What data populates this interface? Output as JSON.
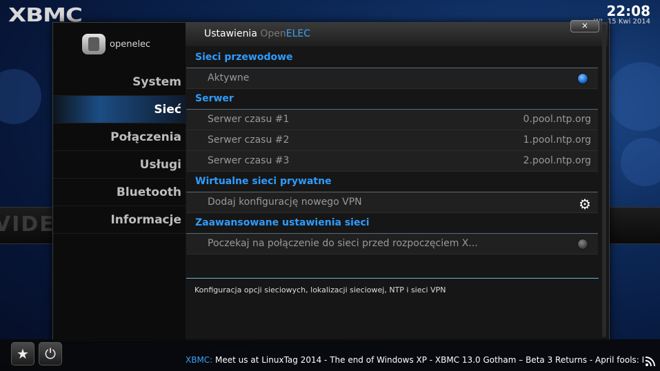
{
  "app": {
    "logo": "XBMC"
  },
  "status": {
    "time": "22:08",
    "date": "Wt, 15 Kwi 2014"
  },
  "background": {
    "band_text": "VIDEO"
  },
  "dialog": {
    "brand": "openelec",
    "title_prefix": "Ustawienia ",
    "title_open": "Open",
    "title_elec": "ELEC",
    "close_label": "×"
  },
  "sidebar": {
    "items": [
      {
        "label": "System",
        "active": false
      },
      {
        "label": "Sieć",
        "active": true
      },
      {
        "label": "Połączenia",
        "active": false
      },
      {
        "label": "Usługi",
        "active": false
      },
      {
        "label": "Bluetooth",
        "active": false
      },
      {
        "label": "Informacje",
        "active": false
      }
    ]
  },
  "settings": {
    "wired_header": "Sieci przewodowe",
    "wired_active_label": "Aktywne",
    "wired_active_on": true,
    "server_header": "Serwer",
    "servers": [
      {
        "label": "Serwer czasu #1",
        "value": "0.pool.ntp.org"
      },
      {
        "label": "Serwer czasu #2",
        "value": "1.pool.ntp.org"
      },
      {
        "label": "Serwer czasu #3",
        "value": "2.pool.ntp.org"
      }
    ],
    "vpn_header": "Wirtualne sieci prywatne",
    "vpn_add_label": "Dodaj konfigurację nowego VPN",
    "advanced_header": "Zaawansowane ustawienia sieci",
    "wait_label": "Poczekaj na połączenie do sieci przed rozpoczęciem X...",
    "wait_on": false
  },
  "description": "Konfiguracja opcji sieciowych, lokalizacji sieciowej, NTP i sieci VPN",
  "ticker": {
    "source": "XBMC: ",
    "text": "Meet us at LinuxTag 2014 - The end of Windows XP - XBMC 13.0 Gotham – Beta 3 Returns - April fools: Intr"
  },
  "icons": {
    "favourites": "star-icon",
    "power": "power-icon",
    "rss": "rss-icon",
    "vpn_add": "gear-icon"
  }
}
